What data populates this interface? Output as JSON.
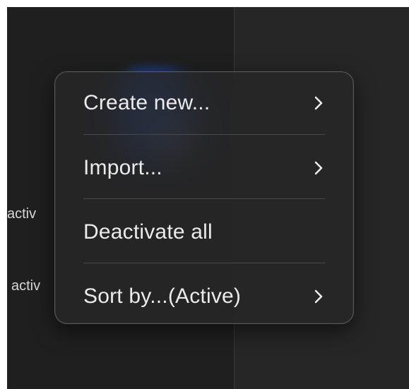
{
  "background": {
    "row_labels": [
      "activ",
      "activ"
    ]
  },
  "context_menu": {
    "items": [
      {
        "label": "Create new...",
        "has_submenu": true
      },
      {
        "label": "Import...",
        "has_submenu": true
      },
      {
        "label": "Deactivate all",
        "has_submenu": false
      },
      {
        "label": "Sort by...(Active)",
        "has_submenu": true
      }
    ]
  },
  "colors": {
    "menu_background": "#262628",
    "menu_border": "#5a5a5c",
    "text": "#ebebeb",
    "separator": "#4a4a4c",
    "accent_blue": "#2b5fc2"
  }
}
